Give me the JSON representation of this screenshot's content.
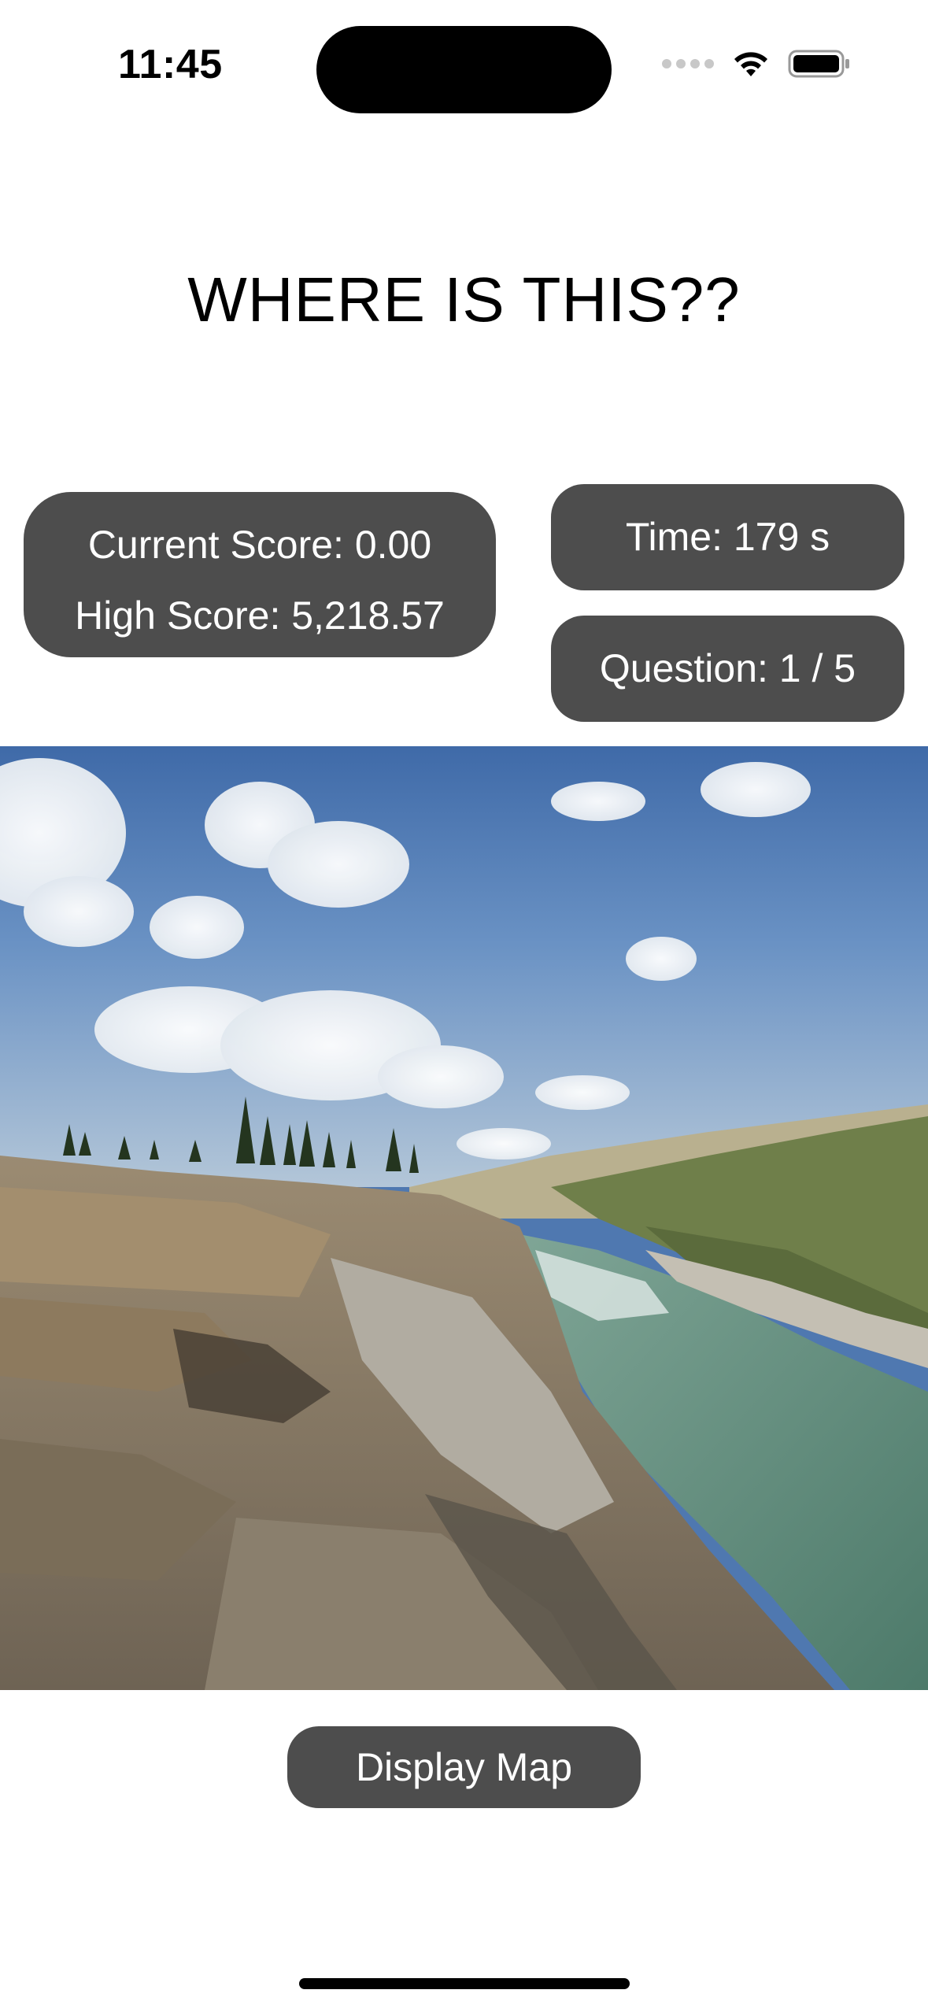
{
  "status_bar": {
    "time": "11:45"
  },
  "title": "WHERE IS THIS??",
  "stats": {
    "current_score": "Current Score: 0.00",
    "high_score": "High Score: 5,218.57",
    "time": "Time: 179 s",
    "question": "Question: 1 / 5"
  },
  "photo": {
    "subject": "street-view-photo"
  },
  "actions": {
    "display_map_label": "Display Map"
  },
  "colors": {
    "pill_background": "#4d4d4d",
    "pill_text": "#ffffff",
    "page_background": "#ffffff"
  },
  "icons": [
    "signal-dots-icon",
    "wifi-icon",
    "battery-icon"
  ]
}
